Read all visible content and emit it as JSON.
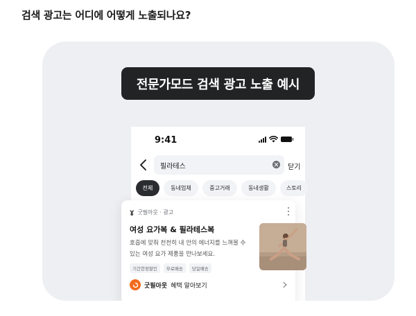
{
  "heading": "검색 광고는 어디에 어떻게 노출되나요?",
  "example_label": "전문가모드 검색 광고 노출 예시",
  "phone": {
    "status_time": "9:41",
    "search": {
      "query": "필라테스",
      "close_label": "닫기"
    },
    "chips": [
      {
        "label": "전체",
        "active": true
      },
      {
        "label": "동네업체",
        "active": false
      },
      {
        "label": "중고거래",
        "active": false
      },
      {
        "label": "동네생활",
        "active": false
      },
      {
        "label": "스토리",
        "active": false
      }
    ]
  },
  "ad": {
    "brand_line": "굿필아웃 · 광고",
    "title": "여성 요가복 & 필라테스복",
    "description": "호흡에 맞춰 천천히 내 안의 에너지를 느껴볼 수 있는 여성 요가 제품을 만나보세요.",
    "tags": [
      "기간한정할인",
      "무료배송",
      "당일배송"
    ],
    "cta_brand": "굿필아웃",
    "cta_text": "혜택 알아보기",
    "cta_color": "#f26b1d"
  },
  "icons": [
    "back-arrow-icon",
    "clear-icon",
    "signal-icon",
    "wifi-icon",
    "battery-icon",
    "more-icon",
    "brand-logo-icon",
    "chevron-right-icon"
  ]
}
